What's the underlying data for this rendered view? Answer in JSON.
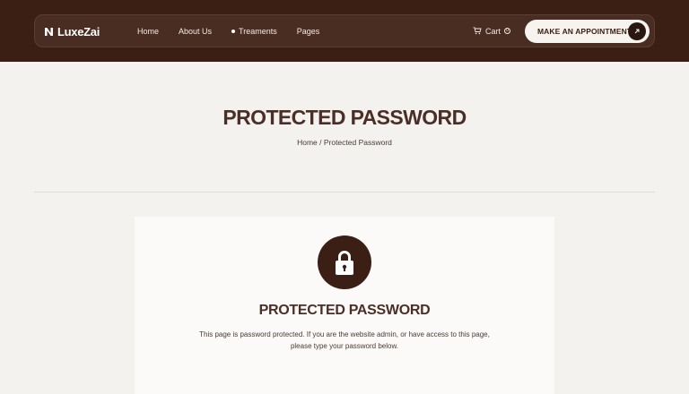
{
  "brand": {
    "name": "LuxeZai"
  },
  "nav": {
    "items": [
      {
        "label": "Home"
      },
      {
        "label": "About Us"
      },
      {
        "label": "Treaments"
      },
      {
        "label": "Pages"
      }
    ],
    "cart_label": "Cart",
    "cart_count": "0",
    "appointment_label": "MAKE AN APPOINTMENT"
  },
  "hero": {
    "title": "PROTECTED PASSWORD",
    "breadcrumb": "Home / Protected Password"
  },
  "card": {
    "icon": "lock-icon",
    "title": "PROTECTED PASSWORD",
    "description": "This page is password protected. If you are the website admin, or have access to this page, please type your password below."
  },
  "colors": {
    "header_bg": "#3b1f15",
    "page_bg": "#f4f2ee",
    "accent_dark": "#3b1f15"
  }
}
